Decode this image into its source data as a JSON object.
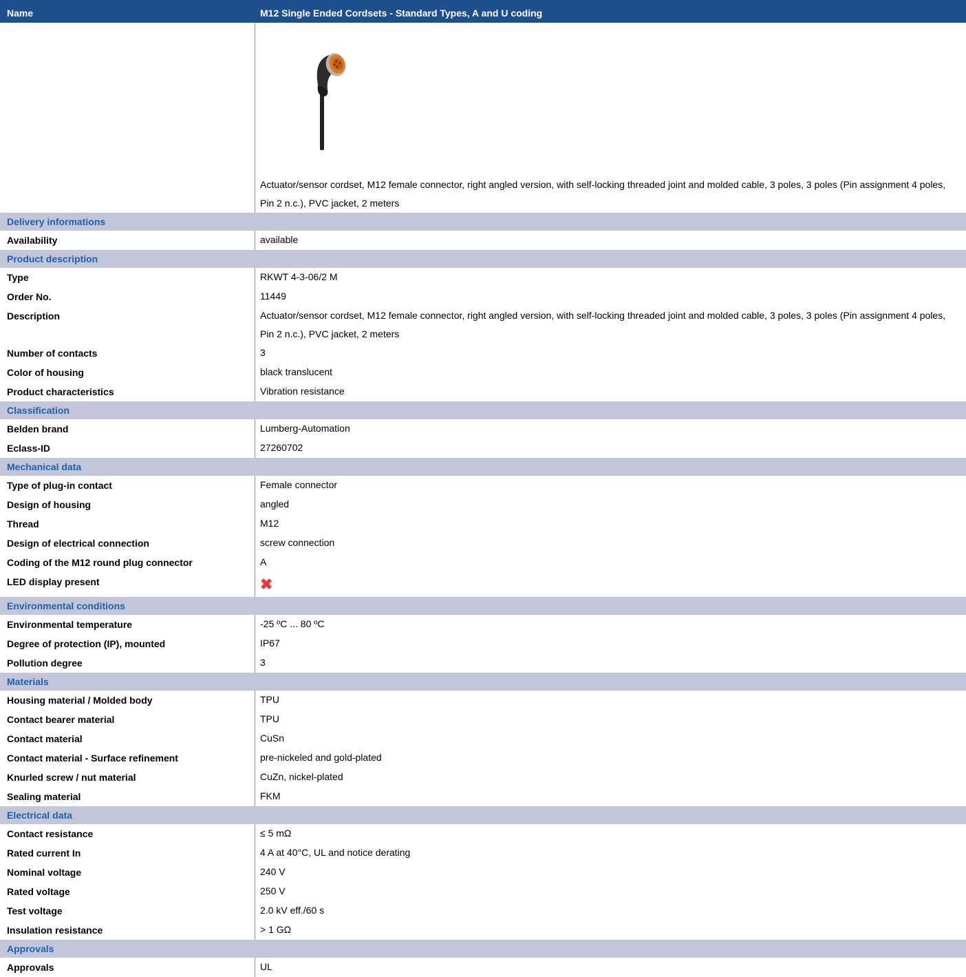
{
  "header": {
    "name_label": "Name",
    "product_name": "M12 Single Ended Cordsets - Standard Types, A and U coding"
  },
  "description_text": "Actuator/sensor cordset, M12 female connector, right angled version, with self-locking threaded joint and molded cable, 3 poles, 3 poles (Pin assignment 4 poles, Pin 2 n.c.), PVC jacket, 2 meters",
  "image": {
    "icon": "angled-m12-female-cordset"
  },
  "sections": [
    {
      "title": "Delivery informations",
      "rows": [
        {
          "label": "Availability",
          "value": "available"
        }
      ]
    },
    {
      "title": "Product description",
      "rows": [
        {
          "label": "Type",
          "value": "RKWT 4-3-06/2 M"
        },
        {
          "label": "Order No.",
          "value": "11449"
        },
        {
          "label": "Description",
          "value": "Actuator/sensor cordset, M12 female connector, right angled version, with self-locking threaded joint and molded cable, 3 poles, 3 poles (Pin assignment 4 poles, Pin 2 n.c.), PVC jacket, 2 meters"
        },
        {
          "label": "Number of contacts",
          "value": "3"
        },
        {
          "label": "Color of housing",
          "value": "black translucent"
        },
        {
          "label": "Product characteristics",
          "value": "Vibration resistance"
        }
      ]
    },
    {
      "title": "Classification",
      "rows": [
        {
          "label": "Belden brand",
          "value": "Lumberg-Automation"
        },
        {
          "label": "Eclass-ID",
          "value": "27260702"
        }
      ]
    },
    {
      "title": "Mechanical data",
      "rows": [
        {
          "label": "Type of plug-in contact",
          "value": "Female connector"
        },
        {
          "label": "Design of housing",
          "value": "angled"
        },
        {
          "label": "Thread",
          "value": "M12"
        },
        {
          "label": "Design of electrical connection",
          "value": "screw connection"
        },
        {
          "label": "Coding of the M12 round plug connector",
          "value": "A"
        },
        {
          "label": "LED display present",
          "value": "✖",
          "icon": "red-x-icon"
        }
      ]
    },
    {
      "title": "Environmental conditions",
      "rows": [
        {
          "label": "Environmental temperature",
          "value": "-25 ºC ... 80 ºC"
        },
        {
          "label": "Degree of protection (IP), mounted",
          "value": "IP67"
        },
        {
          "label": "Pollution degree",
          "value": "3"
        }
      ]
    },
    {
      "title": "Materials",
      "rows": [
        {
          "label": "Housing material / Molded body",
          "value": "TPU"
        },
        {
          "label": "Contact bearer material",
          "value": "TPU"
        },
        {
          "label": "Contact material",
          "value": "CuSn"
        },
        {
          "label": "Contact material - Surface refinement",
          "value": "pre-nickeled and gold-plated"
        },
        {
          "label": "Knurled screw / nut material",
          "value": "CuZn, nickel-plated"
        },
        {
          "label": "Sealing material",
          "value": "FKM"
        }
      ]
    },
    {
      "title": "Electrical data",
      "rows": [
        {
          "label": "Contact resistance",
          "value": "≤ 5 mΩ"
        },
        {
          "label": "Rated current In",
          "value": "4 A at 40°C, UL and notice derating"
        },
        {
          "label": "Nominal voltage",
          "value": "240 V"
        },
        {
          "label": "Rated voltage",
          "value": "250 V"
        },
        {
          "label": "Test voltage",
          "value": "2.0 kV eff./60 s"
        },
        {
          "label": "Insulation resistance",
          "value": "> 1 GΩ"
        }
      ]
    },
    {
      "title": "Approvals",
      "rows": [
        {
          "label": "Approvals",
          "value": "UL"
        }
      ]
    }
  ],
  "colors": {
    "header_bg": "#1f4e8c",
    "section_bg": "#c3c6d8",
    "section_text": "#1f5fb0",
    "x_mark": "#e23b3b"
  }
}
